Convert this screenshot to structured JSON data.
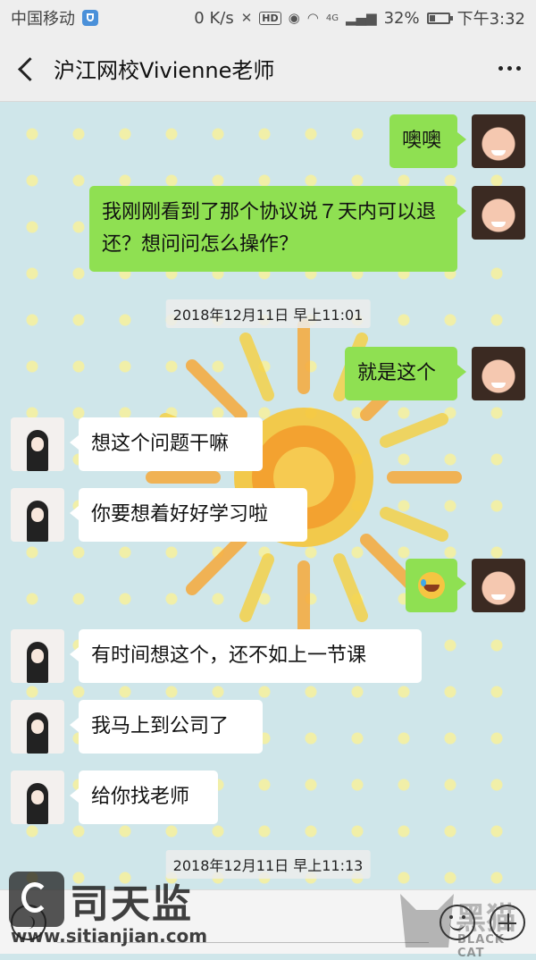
{
  "status_bar": {
    "carrier": "中国移动",
    "speed": "0 K/s",
    "hd": "HD",
    "network": "4G",
    "battery": "32%",
    "battery_level": 0.32,
    "time": "下午3:32"
  },
  "header": {
    "title": "沪江网校Vivienne老师"
  },
  "messages": [
    {
      "side": "right",
      "text": "噢噢"
    },
    {
      "side": "right",
      "text": "我刚刚看到了那个协议说７天内可以退还？想问问怎么操作？"
    },
    {
      "timestamp": "2018年12月11日 早上11:01"
    },
    {
      "side": "right",
      "text": "就是这个"
    },
    {
      "side": "left",
      "text": "想这个问题干嘛"
    },
    {
      "side": "left",
      "text": "你要想着好好学习啦"
    },
    {
      "side": "right",
      "emoji": "laughing-crying-emoji"
    },
    {
      "side": "left",
      "text": "有时间想这个，还不如上一节课"
    },
    {
      "side": "left",
      "text": "我马上到公司了"
    },
    {
      "side": "left",
      "text": "给你找老师"
    },
    {
      "timestamp": "2018年12月11日 早上11:13"
    }
  ],
  "watermarks": {
    "left_main": "司天监",
    "left_sub": "www.sitianjian.com",
    "right_cn": "黑猫",
    "right_en": "BLACK CAT"
  }
}
